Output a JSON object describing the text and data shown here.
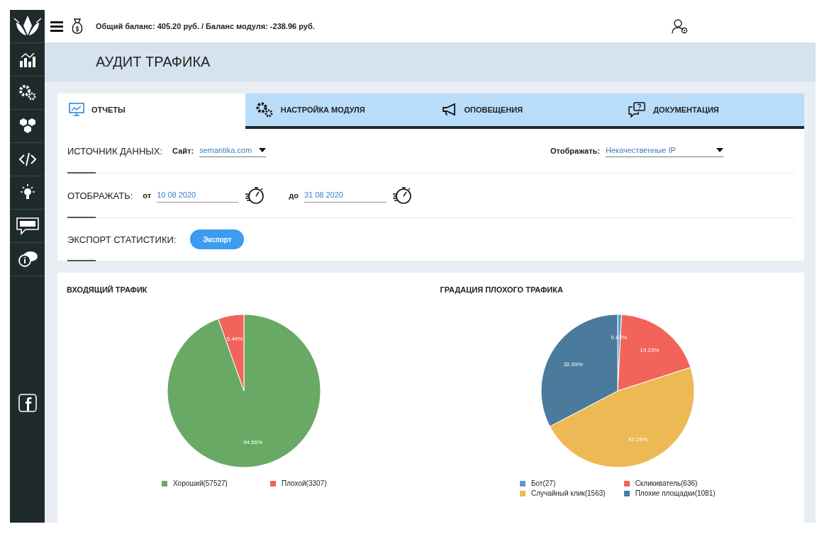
{
  "topbar": {
    "balance": "Общий баланс: 405.20 руб. / Баланс модуля: -238.96 руб."
  },
  "page_title": "АУДИТ ТРАФИКА",
  "tabs": [
    {
      "label": "ОТЧЕТЫ",
      "selected": true
    },
    {
      "label": "НАСТРОЙКА МОДУЛЯ",
      "selected": false
    },
    {
      "label": "ОПОВЕЩЕНИЯ",
      "selected": false
    },
    {
      "label": "ДОКУМЕНТАЦИЯ",
      "selected": false
    }
  ],
  "filters": {
    "source_label": "ИСТОЧНИК ДАННЫХ:",
    "site_label": "Сайт:",
    "site_value": "semantika.com",
    "show_label": "Отображать:",
    "show_value": "Некачественные IP",
    "period_label": "ОТОБРАЖАТЬ:",
    "from_label": "от",
    "from_value": "10 08 2020",
    "to_label": "до",
    "to_value": "31 08 2020",
    "export_label": "ЭКСПОРТ СТАТИСТИКИ:",
    "export_button": "Экспорт"
  },
  "charts": [
    {
      "chart_data": {
        "type": "pie",
        "title": "ВХОДЯЩИЙ ТРАФИК",
        "categories": [
          "Хороший(57527)",
          "Плохой(3307)"
        ],
        "values": [
          94.56,
          5.44
        ],
        "value_labels": [
          "94.56%",
          "5.44%"
        ]
      },
      "legend": [
        {
          "color": "#68a965"
        },
        {
          "color": "#f2645a"
        }
      ]
    },
    {
      "chart_data": {
        "type": "pie",
        "title": "ГРАДАЦИЯ ПЛОХОГО ТРАФИКА",
        "categories": [
          "Бот(27)",
          "Скликиватель(636)",
          "Случайный клик(1563)",
          "Плохие площадки(1081)"
        ],
        "values": [
          0.82,
          19.23,
          47.26,
          32.69
        ],
        "value_labels": [
          "0.82%",
          "19.23%",
          "47.26%",
          "32.69%"
        ]
      },
      "legend": [
        {
          "color": "#5b9bd0"
        },
        {
          "color": "#f2645a"
        },
        {
          "color": "#edb954"
        },
        {
          "color": "#4a7a9c"
        }
      ]
    }
  ]
}
